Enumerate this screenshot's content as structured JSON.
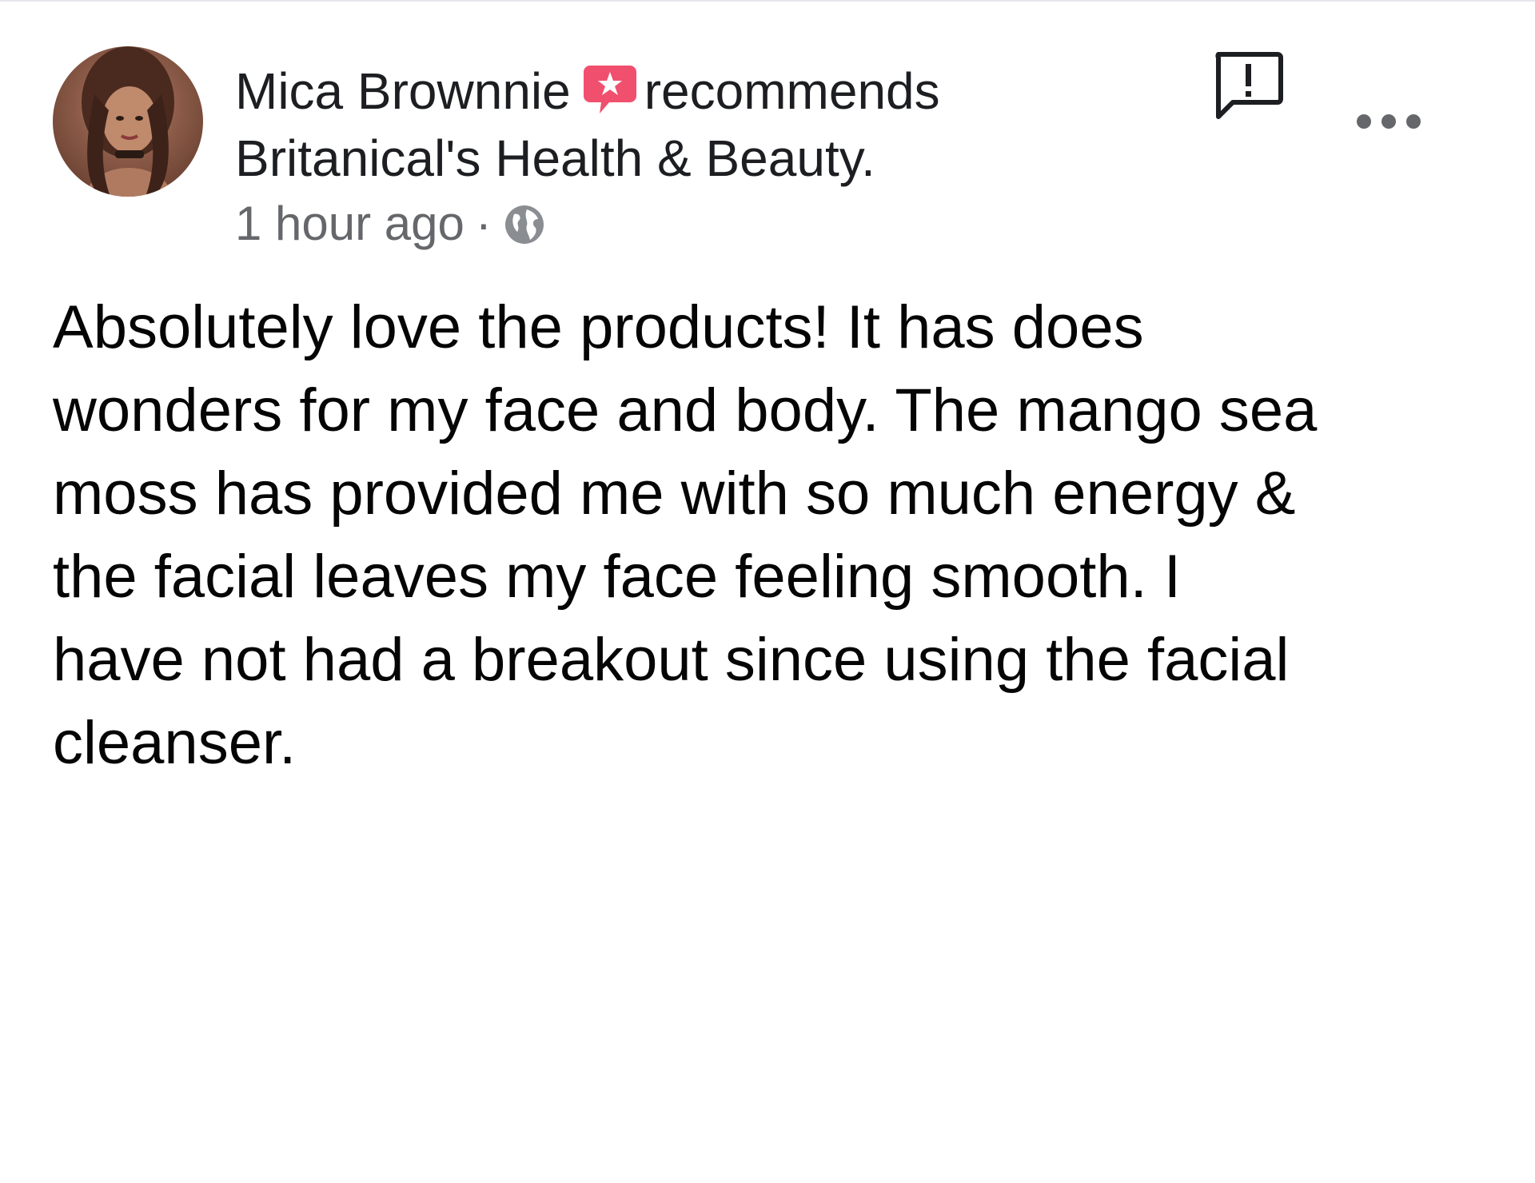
{
  "post": {
    "author": "Mica Brownnie",
    "action": "recommends",
    "page": "Britanical's Health & Beauty.",
    "timestamp": "1 hour ago",
    "separator": "·",
    "privacy_icon": "globe-icon",
    "body_text": "Absolutely love the products! It has does\nwonders for my face and body. The mango sea\nmoss has provided me with so much energy &\nthe facial leaves my face feeling smooth. I\nhave not had a breakout since using the facial\ncleanser.",
    "recommend_icon": "recommend-star-icon",
    "report_icon": "report-icon",
    "more_icon": "more-options-icon"
  },
  "colors": {
    "recommend_accent": "#f0506e",
    "meta_text": "#65676b",
    "primary_text": "#1c1e21",
    "icon_gray": "#8a8d91"
  }
}
